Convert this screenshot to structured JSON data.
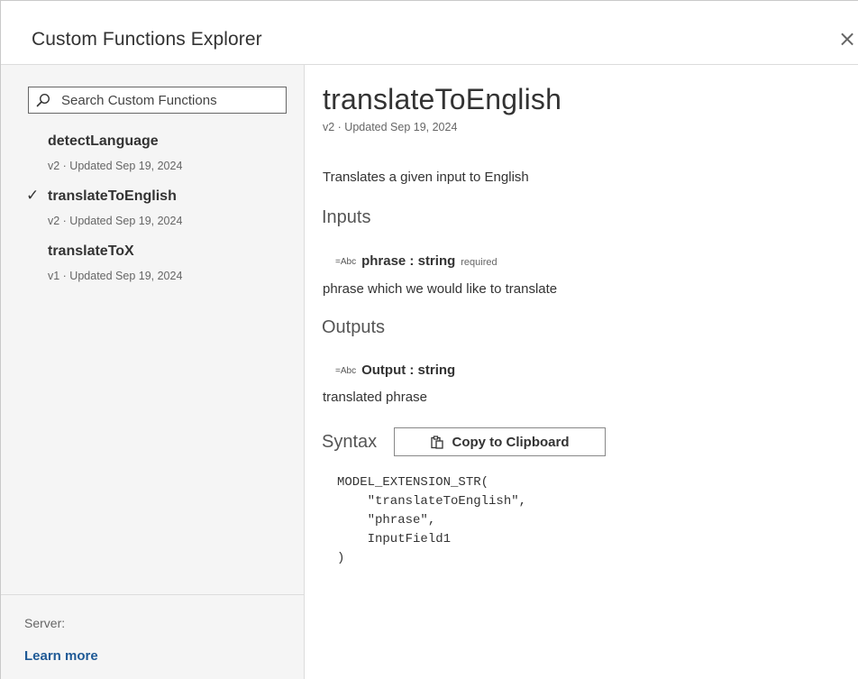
{
  "window": {
    "title": "Custom Functions Explorer",
    "close_glyph": "×"
  },
  "sidebar": {
    "search": {
      "placeholder": "Search Custom Functions",
      "value": ""
    },
    "functions": [
      {
        "name": "detectLanguage",
        "meta": "v2 · Updated Sep 19, 2024",
        "selected": false,
        "check": ""
      },
      {
        "name": "translateToEnglish",
        "meta": "v2 · Updated Sep 19, 2024",
        "selected": true,
        "check": "✓"
      },
      {
        "name": "translateToX",
        "meta": "v1 · Updated Sep 19, 2024",
        "selected": false,
        "check": ""
      }
    ],
    "footer": {
      "server_label": "Server:",
      "learn_more": "Learn more"
    }
  },
  "detail": {
    "title": "translateToEnglish",
    "meta": "v2 · Updated Sep 19, 2024",
    "description": "Translates a given input to English",
    "inputs_heading": "Inputs",
    "inputs": [
      {
        "type_icon": "=Abc",
        "signature": "phrase : string",
        "tag": "required",
        "description": "phrase which we would like to translate"
      }
    ],
    "outputs_heading": "Outputs",
    "outputs": [
      {
        "type_icon": "=Abc",
        "signature": "Output : string",
        "description": "translated phrase"
      }
    ],
    "syntax_heading": "Syntax",
    "copy_button_label": "Copy to Clipboard",
    "syntax_code": "MODEL_EXTENSION_STR(\n    \"translateToEnglish\",\n    \"phrase\",\n    InputField1\n)"
  },
  "icons": {
    "search": "search-icon",
    "close": "close-icon",
    "checkmark": "checkmark-icon",
    "clipboard": "clipboard-icon",
    "string_type": "string-type-icon"
  },
  "colors": {
    "link": "#1f5a96",
    "sidebar_bg": "#f5f5f5",
    "text": "#333333",
    "muted_text": "#666666"
  }
}
